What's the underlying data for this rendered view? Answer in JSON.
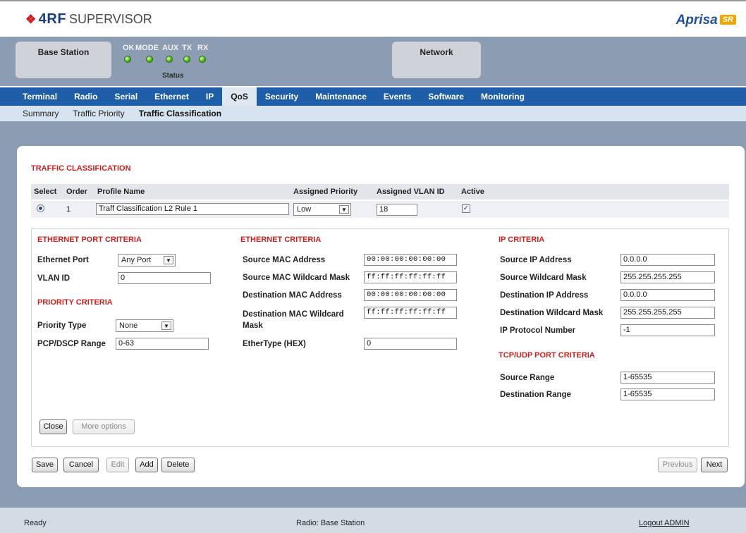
{
  "header": {
    "logo_text": "4RF",
    "logo_sub": "SUPERVISOR",
    "brand_name": "Aprisa",
    "brand_badge": "SR"
  },
  "status_panel": {
    "station_label": "Base Station",
    "network_label": "Network",
    "led_labels": [
      "OK",
      "MODE",
      "AUX",
      "TX",
      "RX"
    ],
    "led_color": "#46b216",
    "status_label": "Status"
  },
  "nav": {
    "tabs": [
      "Terminal",
      "Radio",
      "Serial",
      "Ethernet",
      "IP",
      "QoS",
      "Security",
      "Maintenance",
      "Events",
      "Software",
      "Monitoring"
    ],
    "active": "QoS"
  },
  "subnav": {
    "tabs": [
      "Summary",
      "Traffic Priority",
      "Traffic Classification"
    ],
    "active": "Traffic Classification"
  },
  "traffic_classification": {
    "title": "TRAFFIC CLASSIFICATION",
    "columns": [
      "Select",
      "Order",
      "Profile Name",
      "Assigned Priority",
      "Assigned VLAN ID",
      "Active"
    ],
    "row": {
      "selected": true,
      "order": "1",
      "profile_name": "Traff Classification L2 Rule 1",
      "assigned_priority": "Low",
      "assigned_vlan_id": "18",
      "active": true
    }
  },
  "ethernet_port_criteria": {
    "title": "ETHERNET PORT CRITERIA",
    "ethernet_port_label": "Ethernet Port",
    "ethernet_port_value": "Any Port",
    "vlan_id_label": "VLAN ID",
    "vlan_id_value": "0"
  },
  "priority_criteria": {
    "title": "PRIORITY CRITERIA",
    "priority_type_label": "Priority Type",
    "priority_type_value": "None",
    "pcp_range_label": "PCP/DSCP Range",
    "pcp_range_value": "0-63"
  },
  "ethernet_criteria": {
    "title": "ETHERNET CRITERIA",
    "src_mac_label": "Source MAC Address",
    "src_mac_value": "00:00:00:00:00:00",
    "src_mac_mask_label": "Source MAC Wildcard Mask",
    "src_mac_mask_value": "ff:ff:ff:ff:ff:ff",
    "dst_mac_label": "Destination MAC Address",
    "dst_mac_value": "00:00:00:00:00:00",
    "dst_mac_mask_label": "Destination MAC Wildcard Mask",
    "dst_mac_mask_value": "ff:ff:ff:ff:ff:ff",
    "ethertype_label": "EtherType (HEX)",
    "ethertype_value": "0"
  },
  "ip_criteria": {
    "title": "IP CRITERIA",
    "src_ip_label": "Source IP Address",
    "src_ip_value": "0.0.0.0",
    "src_mask_label": "Source Wildcard Mask",
    "src_mask_value": "255.255.255.255",
    "dst_ip_label": "Destination IP Address",
    "dst_ip_value": "0.0.0.0",
    "dst_mask_label": "Destination Wildcard Mask",
    "dst_mask_value": "255.255.255.255",
    "protocol_label": "IP Protocol Number",
    "protocol_value": "-1"
  },
  "tcp_udp_criteria": {
    "title": "TCP/UDP PORT CRITERIA",
    "src_range_label": "Source Range",
    "src_range_value": "1-65535",
    "dst_range_label": "Destination Range",
    "dst_range_value": "1-65535"
  },
  "buttons": {
    "close": "Close",
    "more_options": "More options",
    "save": "Save",
    "cancel": "Cancel",
    "edit": "Edit",
    "add": "Add",
    "delete": "Delete",
    "previous": "Previous",
    "next": "Next"
  },
  "footer": {
    "status": "Ready",
    "radio": "Radio: Base Station",
    "logout": "Logout ADMIN"
  }
}
